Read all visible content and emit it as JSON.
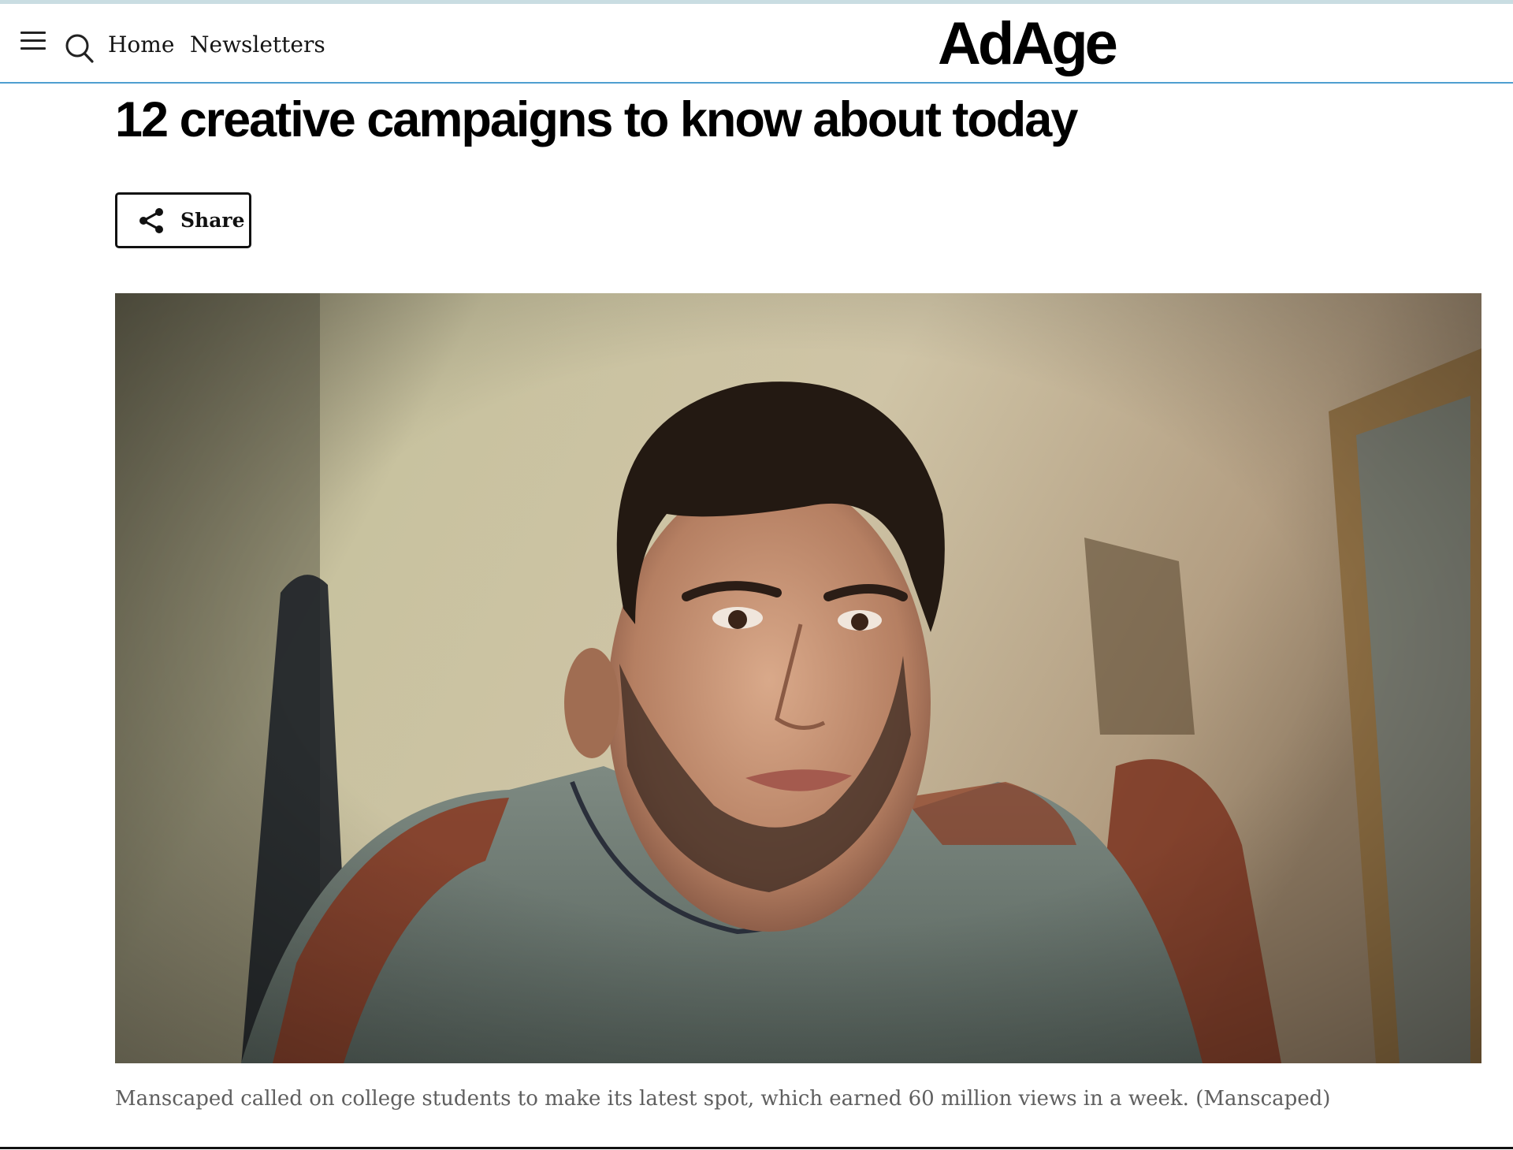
{
  "header": {
    "menu_icon": "hamburger-menu-icon",
    "search_icon": "search-icon",
    "nav": [
      {
        "label": "Home"
      },
      {
        "label": "Newsletters"
      }
    ],
    "logo_text": "AdAge",
    "accent_color": "#4f9fd0"
  },
  "article": {
    "headline": "12 creative campaigns to know about today",
    "share_label": "Share",
    "share_icon": "share-icon",
    "hero_caption": "Manscaped called on college students to make its latest spot, which earned 60 million views in a week. (Manscaped)"
  }
}
